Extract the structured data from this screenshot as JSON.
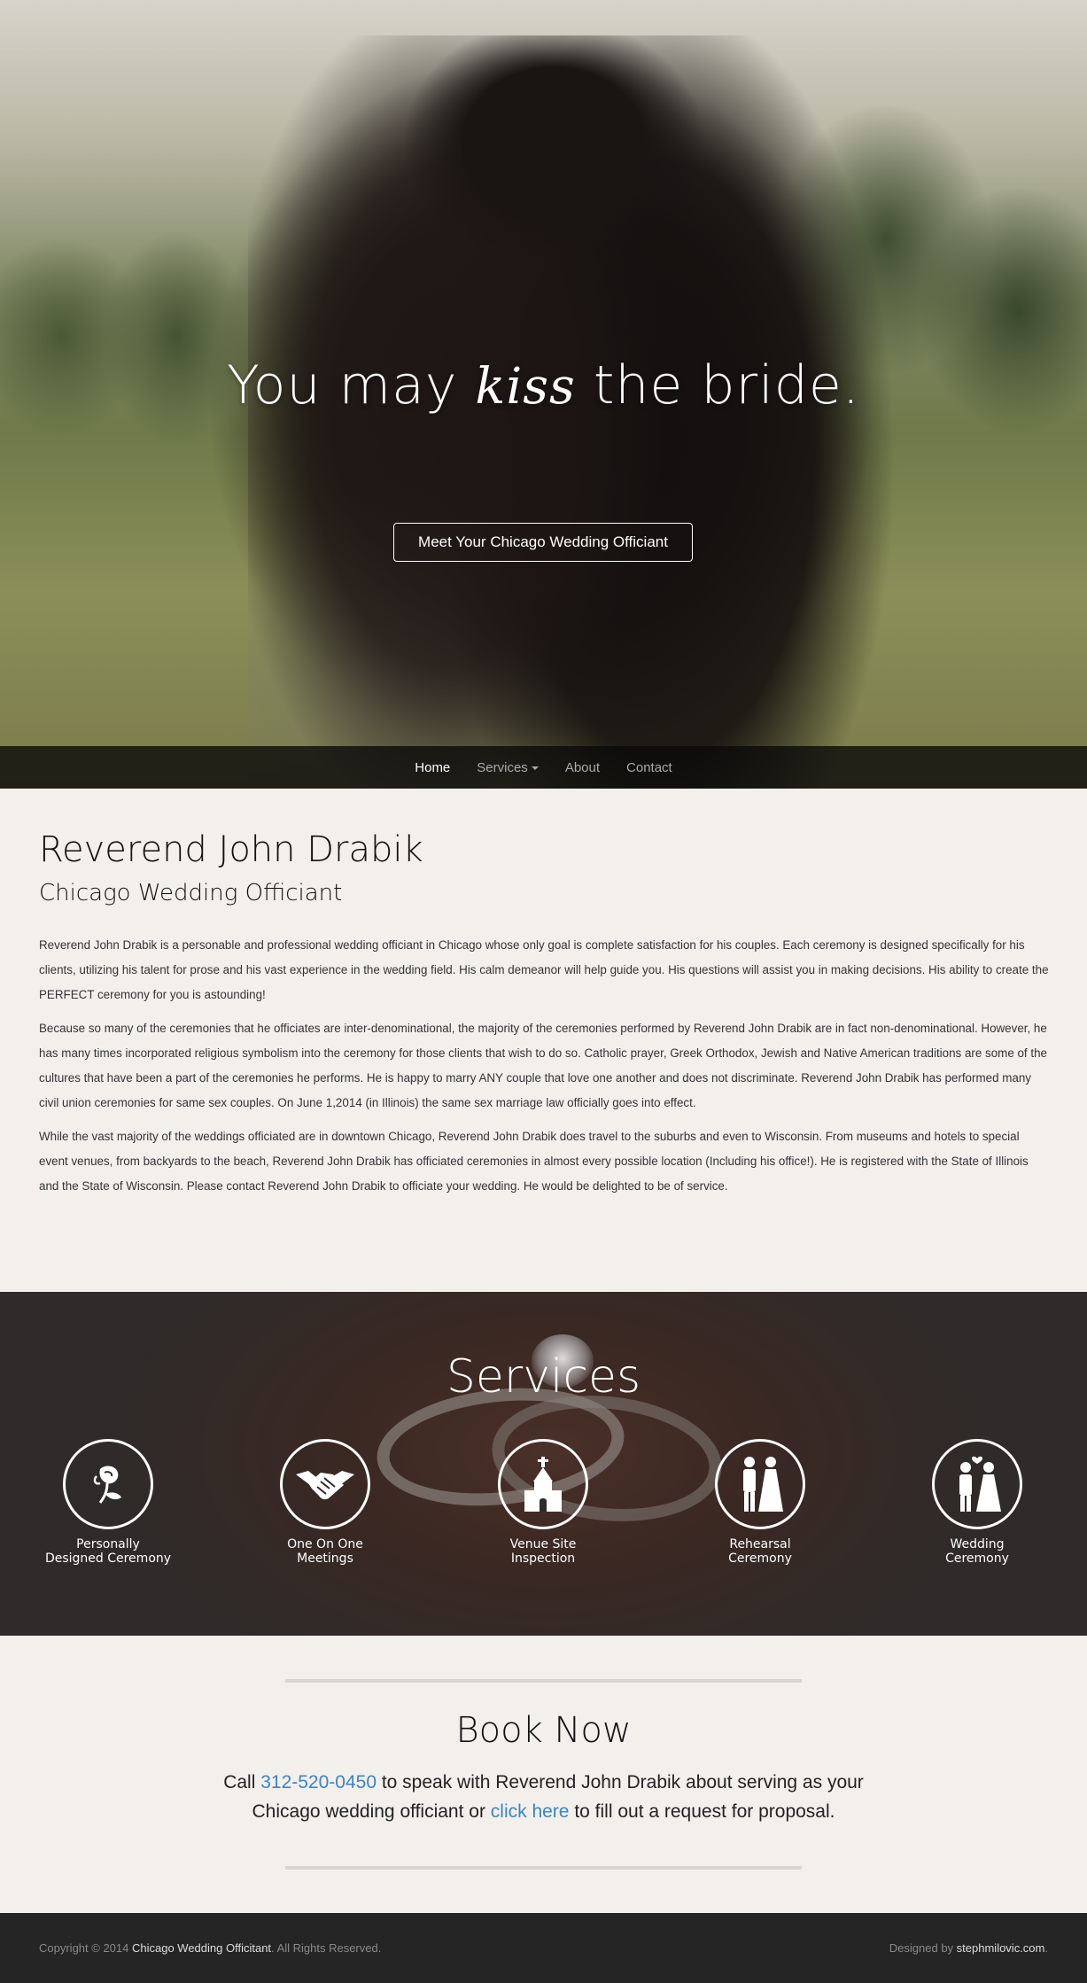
{
  "hero": {
    "title_before": "You may ",
    "title_kiss": "kiss",
    "title_after": " the bride.",
    "cta_label": "Meet Your Chicago Wedding Officiant"
  },
  "nav": {
    "items": [
      {
        "label": "Home"
      },
      {
        "label": "Services"
      },
      {
        "label": "About"
      },
      {
        "label": "Contact"
      }
    ]
  },
  "about": {
    "title": "Reverend John Drabik",
    "subtitle": "Chicago Wedding Officiant",
    "paragraphs": [
      "Reverend John Drabik is a personable and professional wedding officiant in Chicago whose only goal is complete satisfaction for his couples. Each ceremony is designed specifically for his clients, utilizing his talent for prose and his vast experience in the wedding field. His calm demeanor will help guide you. His questions will assist you in making decisions. His ability to create the PERFECT ceremony for you is astounding!",
      "Because so many of the ceremonies that he officiates are inter-denominational, the majority of the ceremonies performed by Reverend John Drabik are in fact non-denominational. However, he has many times incorporated religious symbolism into the ceremony for those clients that wish to do so. Catholic prayer, Greek Orthodox, Jewish and Native American traditions are some of the cultures that have been a part of the ceremonies he performs. He is happy to marry ANY couple that love one another and does not discriminate. Reverend John Drabik has performed many civil union ceremonies for same sex couples. On June 1,2014 (in Illinois) the same sex marriage law officially goes into effect.",
      "While the vast majority of the weddings officiated are in downtown Chicago, Reverend John Drabik does travel to the suburbs and even to Wisconsin. From museums and hotels to special event venues, from backyards to the beach, Reverend John Drabik has officiated ceremonies in almost every possible location (Including his office!). He is registered with the State of Illinois and the State of Wisconsin. Please contact Reverend John Drabik to officiate your wedding. He would be delighted to be of service."
    ]
  },
  "services": {
    "title": "Services",
    "items": [
      {
        "line1": "Personally",
        "line2": "Designed Ceremony",
        "icon": "rose-icon"
      },
      {
        "line1": "One On One",
        "line2": "Meetings",
        "icon": "handshake-icon"
      },
      {
        "line1": "Venue Site",
        "line2": "Inspection",
        "icon": "chapel-icon"
      },
      {
        "line1": "Rehearsal",
        "line2": "Ceremony",
        "icon": "couple-icon"
      },
      {
        "line1": "Wedding",
        "line2": "Ceremony",
        "icon": "bride-groom-icon"
      }
    ]
  },
  "book": {
    "title": "Book Now",
    "call": "Call ",
    "phone": "312-520-0450",
    "mid": " to speak with Reverend John Drabik about serving as your Chicago wedding officiant or ",
    "link": "click here",
    "end": " to fill out a request for proposal."
  },
  "footer": {
    "copyright_prefix": "Copyright © 2014 ",
    "site_name": "Chicago Wedding Officitant",
    "rights": ". All Rights Reserved.",
    "designed_by": "Designed by ",
    "designer": "stephmilovic.com",
    "designer_suffix": "."
  }
}
